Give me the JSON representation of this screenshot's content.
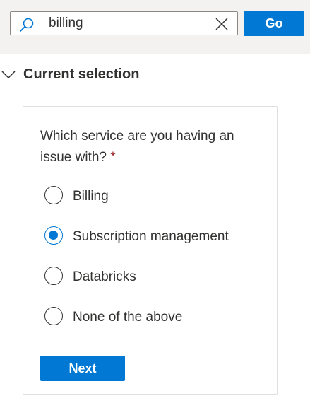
{
  "search": {
    "value": "billing",
    "go_label": "Go"
  },
  "section": {
    "title": "Current selection",
    "expanded": true
  },
  "form": {
    "question": "Which service are you having an issue with?",
    "required_marker": "*",
    "options": [
      {
        "label": "Billing",
        "selected": false
      },
      {
        "label": "Subscription management",
        "selected": true
      },
      {
        "label": "Databricks",
        "selected": false
      },
      {
        "label": "None of the above",
        "selected": false
      }
    ],
    "next_label": "Next"
  },
  "colors": {
    "accent": "#0078d4",
    "required": "#a4262c",
    "topbar_bg": "#f3f2f1"
  },
  "icons": {
    "search": "search-icon",
    "clear": "close-icon",
    "chevron": "chevron-down-icon"
  }
}
